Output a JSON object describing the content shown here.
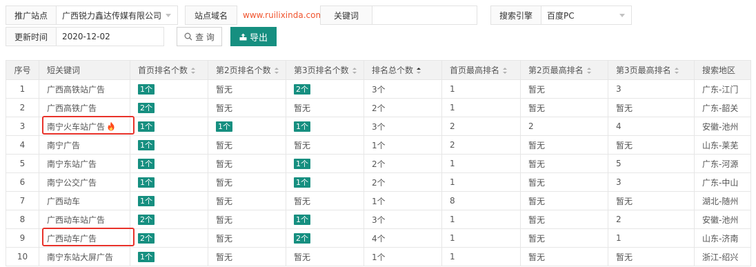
{
  "filters": {
    "site_label": "推广站点",
    "site_value": "广西锐力鑫达传媒有限公司",
    "domain_label": "站点域名",
    "domain_value": "www.ruilixinda.com",
    "keyword_label": "关键词",
    "keyword_value": "",
    "engine_label": "搜索引擎",
    "engine_value": "百度PC",
    "date_label": "更新时间",
    "date_value": "2020-12-02",
    "query_button": "查 询",
    "export_button": "导出"
  },
  "colors": {
    "accent": "#168f80",
    "highlight": "#e8322a",
    "domain": "#f0542e"
  },
  "table": {
    "headers": [
      "序号",
      "短关键词",
      "首页排名个数",
      "第2页排名个数",
      "第3页排名个数",
      "排名总个数",
      "首页最高排名",
      "第2页最高排名",
      "第3页最高排名",
      "搜索地区"
    ],
    "rows": [
      [
        "1",
        "广西高铁站广告",
        "1个",
        "暂无",
        "2个",
        "3个",
        "1",
        "暂无",
        "3",
        "广东-江门"
      ],
      [
        "2",
        "广西高铁广告",
        "2个",
        "暂无",
        "暂无",
        "2个",
        "1",
        "暂无",
        "暂无",
        "广东-韶关"
      ],
      [
        "3",
        "南宁火车站广告",
        "1个",
        "1个",
        "1个",
        "3个",
        "2",
        "2",
        "4",
        "安徽-池州"
      ],
      [
        "4",
        "南宁广告",
        "1个",
        "暂无",
        "暂无",
        "1个",
        "2",
        "暂无",
        "暂无",
        "山东-莱芜"
      ],
      [
        "5",
        "南宁东站广告",
        "1个",
        "暂无",
        "1个",
        "2个",
        "1",
        "暂无",
        "5",
        "广东-河源"
      ],
      [
        "6",
        "南宁公交广告",
        "1个",
        "暂无",
        "1个",
        "2个",
        "1",
        "暂无",
        "3",
        "广东-中山"
      ],
      [
        "7",
        "广西动车",
        "1个",
        "暂无",
        "暂无",
        "1个",
        "8",
        "暂无",
        "暂无",
        "湖北-随州"
      ],
      [
        "8",
        "广西动车站广告",
        "2个",
        "暂无",
        "1个",
        "3个",
        "1",
        "暂无",
        "2",
        "安徽-池州"
      ],
      [
        "9",
        "广西动车广告",
        "2个",
        "暂无",
        "2个",
        "4个",
        "1",
        "暂无",
        "1",
        "山东-济南"
      ],
      [
        "10",
        "南宁东站大屏广告",
        "1个",
        "暂无",
        "暂无",
        "1个",
        "1",
        "暂无",
        "暂无",
        "浙江-绍兴"
      ]
    ],
    "hot_icon": "fire-icon"
  }
}
